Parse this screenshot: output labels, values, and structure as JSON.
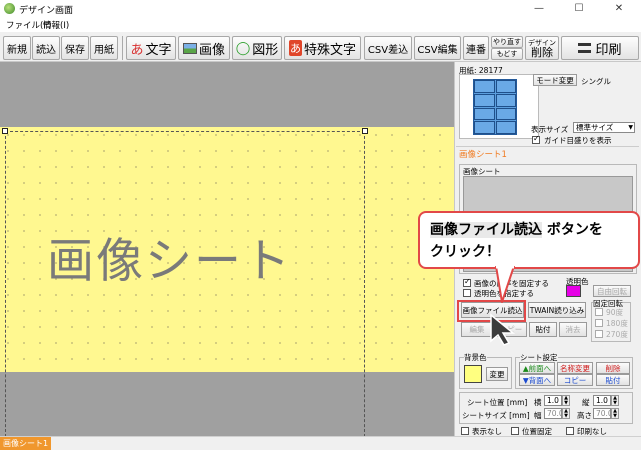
{
  "window": {
    "title": "デザイン画面",
    "minimize": "—",
    "maximize": "☐",
    "close": "✕"
  },
  "menu": [
    "ファイル(F)",
    "情報(I)"
  ],
  "toolbar": {
    "new": "新規",
    "load": "読込",
    "save": "保存",
    "paper": "用紙",
    "text": "文字",
    "text_icon": "あ",
    "image": "画像",
    "shape": "図形",
    "shape_icon": "◯",
    "special_text": "特殊文字",
    "special_icon": "あ",
    "csv_insert": "CSV差込",
    "csv_edit": "CSV編集",
    "serial": "連番",
    "redo": "やり直す",
    "undo": "もどす",
    "delete_top": "デザイン",
    "delete": "削除",
    "print": "印刷"
  },
  "canvas": {
    "sheet_label": "画像シート",
    "status_tab": "画像シート1"
  },
  "panel": {
    "paper_label": "用紙: 28177",
    "mode_button": "モード変更",
    "mode_value": "シングル",
    "display_size_label": "表示サイズ",
    "display_size_value": "標準サイズ",
    "guide_check": "ガイド目盛りを表示",
    "section_title": "画像シート1",
    "list_title": "画像シート",
    "fix_ratio": "画像の比率を固定する",
    "transparent_label": "透明色を指定する",
    "transparent_color_label": "透明色",
    "free_rotate": "自由回転",
    "image_file_load": "画像ファイル読込",
    "twain_load": "TWAIN読り込み",
    "fixed_rotate": "固定回転",
    "rot90": "90度",
    "rot180": "180度",
    "rot270": "270度",
    "edit": "編集",
    "copy": "コピー",
    "paste": "貼付",
    "erase": "消去",
    "bg_color_label": "背景色",
    "bg_change": "変更",
    "sheet_settings": "シート設定",
    "to_front": "▲前面へ",
    "to_back": "▼背面へ",
    "rename": "名称変更",
    "copy2": "コピー",
    "delete2": "削除",
    "paste2": "貼付",
    "pos_label": "シート位置 [mm]",
    "x_label": "横",
    "x_value": "1.0",
    "y_label": "縦",
    "y_value": "1.0",
    "size_label": "シートサイズ [mm]",
    "w_label": "幅",
    "w_value": "70.0",
    "h_label": "高さ",
    "h_value": "70.0",
    "hide": "表示なし",
    "lock_pos": "位置固定",
    "no_print": "印刷なし"
  },
  "callout": {
    "highlight": "画像ファイル読込",
    "line1_rest": " ボタンを",
    "line2": "クリック！"
  },
  "colors": {
    "sheet_yellow": "#fff890",
    "transparent_color": "#e600e6",
    "bg_color": "#ffff80",
    "callout_red": "#e24848",
    "status_orange": "#f0972d"
  }
}
